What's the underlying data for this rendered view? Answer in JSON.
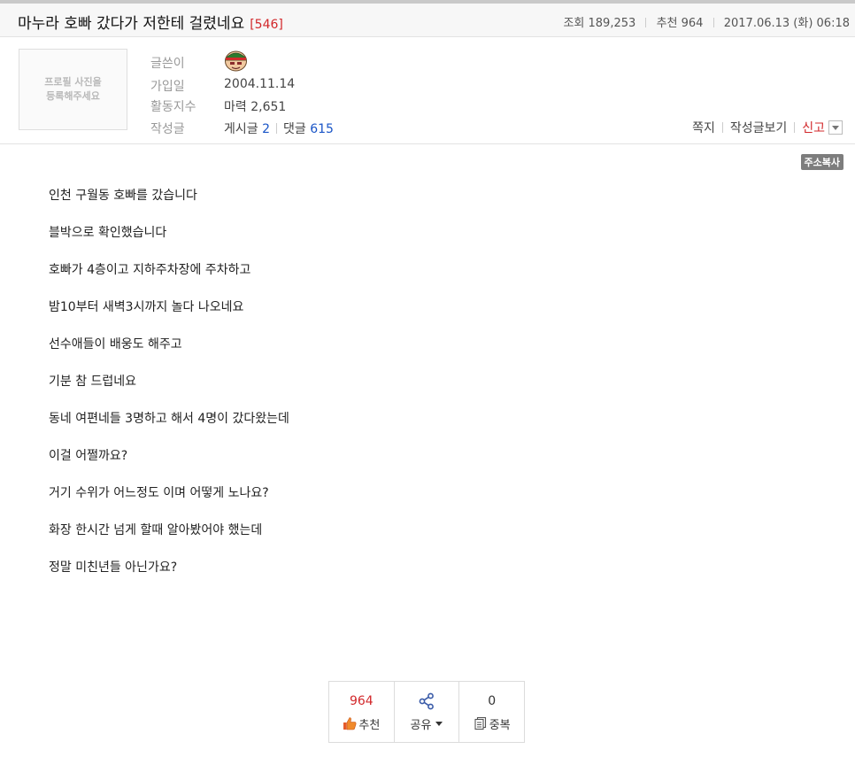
{
  "post": {
    "title": "마누라 호빠 갔다가 저한테 걸렸네요",
    "comment_count": "[546]",
    "views_label": "조회",
    "views": "189,253",
    "recommend_label": "추천",
    "recommend": "964",
    "date": "2017.06.13 (화) 06:18"
  },
  "profile": {
    "placeholder": "프로필 사진을\n등록해주세요",
    "author_label": "글쓴이",
    "avatar_icon": "author-avatar-icon",
    "joined_label": "가입일",
    "joined": "2004.11.14",
    "activity_label": "활동지수",
    "activity": "마력 2,651",
    "posts_label": "작성글",
    "posts_prefix": "게시글",
    "posts_count": "2",
    "comments_prefix": "댓글",
    "comments_count": "615"
  },
  "actions": {
    "message": "쪽지",
    "view_posts": "작성글보기",
    "report": "신고"
  },
  "copy_url": "주소복사",
  "body_lines": [
    "인천 구월동 호빠를 갔습니다",
    "블박으로 확인했습니다",
    "호빠가 4층이고 지하주차장에 주차하고",
    "밤10부터 새벽3시까지 놀다 나오네요",
    "선수애들이 배웅도 해주고",
    "기분 참 드럽네요",
    "동네 여편네들 3명하고 해서 4명이 갔다왔는데",
    "이걸 어쩔까요?",
    "거기 수위가 어느정도 이며 어떻게 노나요?",
    "화장 한시간 넘게 할때 알아봤어야 했는데",
    "정말 미친년들 아닌가요?"
  ],
  "vote": {
    "recommend_count": "964",
    "recommend_label": "추천",
    "share_label": "공유",
    "duplicate_count": "0",
    "duplicate_label": "중복"
  },
  "colors": {
    "accent_red": "#d2282b",
    "link_blue": "#1a55c7"
  }
}
